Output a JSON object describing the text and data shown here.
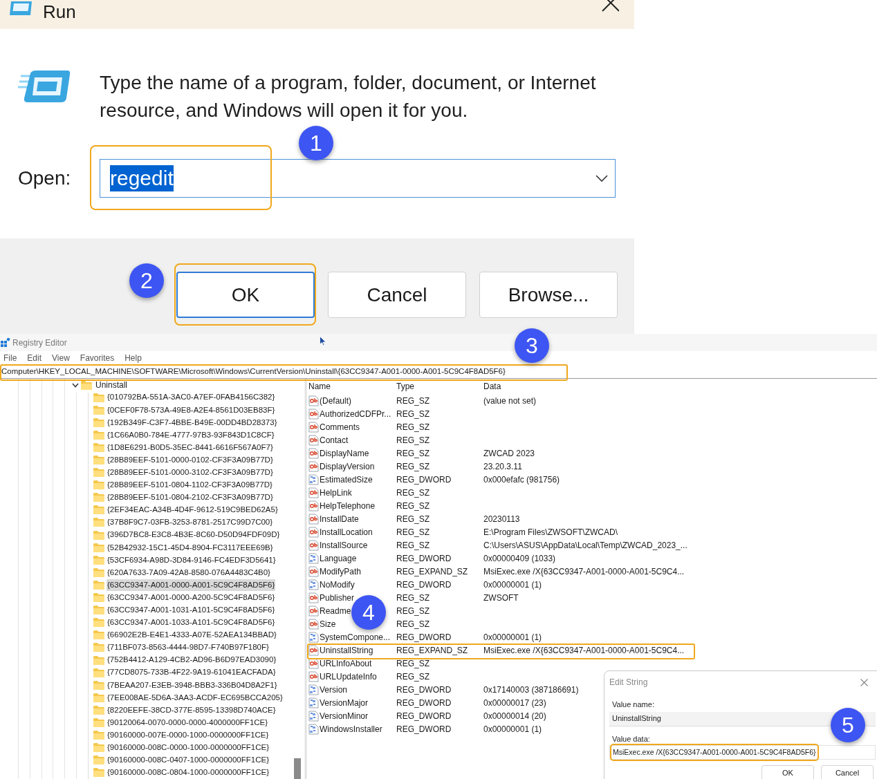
{
  "run_dialog": {
    "title": "Run",
    "description": "Type the name of a program, folder, document, or Internet resource, and Windows will open it for you.",
    "open_label": "Open:",
    "open_value": "regedit",
    "buttons": [
      {
        "label": "OK",
        "focused": true
      },
      {
        "label": "Cancel",
        "focused": false
      },
      {
        "label": "Browse...",
        "focused": false
      }
    ]
  },
  "registry_editor": {
    "title": "Registry Editor",
    "menu": [
      "File",
      "Edit",
      "View",
      "Favorites",
      "Help"
    ],
    "address": "Computer\\HKEY_LOCAL_MACHINE\\SOFTWARE\\Microsoft\\Windows\\CurrentVersion\\Uninstall\\{63CC9347-A001-0000-A001-5C9C4F8AD5F6}",
    "tree": {
      "label": "Uninstall",
      "expanded": true,
      "children": [
        {
          "label": "{010792BA-551A-3AC0-A7EF-0FAB4156C382}",
          "selected": false
        },
        {
          "label": "{0CEF0F78-573A-49E8-A2E4-8561D03EB83F}",
          "selected": false
        },
        {
          "label": "{192B349F-C3F7-4BBE-B49E-00DD4BD28373}",
          "selected": false
        },
        {
          "label": "{1C66A0B0-784E-4777-97B3-93F843D1C8CF}",
          "selected": false
        },
        {
          "label": "{1D8E6291-B0D5-35EC-8441-6616F567A0F7}",
          "selected": false
        },
        {
          "label": "{28B89EEF-5101-0000-0102-CF3F3A09B77D}",
          "selected": false
        },
        {
          "label": "{28B89EEF-5101-0000-3102-CF3F3A09B77D}",
          "selected": false
        },
        {
          "label": "{28B89EEF-5101-0804-1102-CF3F3A09B77D}",
          "selected": false
        },
        {
          "label": "{28B89EEF-5101-0804-2102-CF3F3A09B77D}",
          "selected": false
        },
        {
          "label": "{2EF34EAC-A34B-4D4F-9612-519C9BED62A5}",
          "selected": false
        },
        {
          "label": "{37B8F9C7-03FB-3253-8781-2517C99D7C00}",
          "selected": false
        },
        {
          "label": "{396D7BC8-E3C8-4B3E-8C60-D50D94FDF09D}",
          "selected": false
        },
        {
          "label": "{52B42932-15C1-45D4-8904-FC3117EEE69B}",
          "selected": false
        },
        {
          "label": "{53CF6934-A98D-3D84-9146-FC4EDF3D5641}",
          "selected": false
        },
        {
          "label": "{620A7633-7A09-42A8-8580-076A4483C4B0}",
          "selected": false
        },
        {
          "label": "{63CC9347-A001-0000-A001-5C9C4F8AD5F6}",
          "selected": true
        },
        {
          "label": "{63CC9347-A001-0000-A200-5C9C4F8AD5F6}",
          "selected": false
        },
        {
          "label": "{63CC9347-A001-1031-A101-5C9C4F8AD5F6}",
          "selected": false
        },
        {
          "label": "{63CC9347-A001-1033-A101-5C9C4F8AD5F6}",
          "selected": false
        },
        {
          "label": "{66902E2B-E4E1-4333-A07E-52AEA134BBAD}",
          "selected": false
        },
        {
          "label": "{711BF073-8563-4444-98D7-F740B97F180F}",
          "selected": false
        },
        {
          "label": "{752B4412-A129-4CB2-AD96-B6D97EAD3090}",
          "selected": false
        },
        {
          "label": "{77CD8075-733B-4F22-9A19-61041EACFADA}",
          "selected": false
        },
        {
          "label": "{7BEAA207-E3EB-3948-BBB3-336B04D8A2F1}",
          "selected": false
        },
        {
          "label": "{7EE008AE-5D6A-3AA3-ACDF-EC695BCCA205}",
          "selected": false
        },
        {
          "label": "{8220EEFE-38CD-377E-8595-13398D740ACE}",
          "selected": false
        },
        {
          "label": "{90120064-0070-0000-0000-4000000FF1CE}",
          "selected": false
        },
        {
          "label": "{90160000-007E-0000-1000-0000000FF1CE}",
          "selected": false
        },
        {
          "label": "{90160000-008C-0000-1000-0000000FF1CE}",
          "selected": false
        },
        {
          "label": "{90160000-008C-0407-1000-0000000FF1CE}",
          "selected": false
        },
        {
          "label": "{90160000-008C-0804-1000-0000000FF1CE}",
          "selected": false
        }
      ]
    },
    "columns": [
      "Name",
      "Type",
      "Data"
    ],
    "values": [
      {
        "kind": "string",
        "name": "(Default)",
        "type": "REG_SZ",
        "data": "(value not set)"
      },
      {
        "kind": "string",
        "name": "AuthorizedCDFPr...",
        "type": "REG_SZ"
      },
      {
        "kind": "string",
        "name": "Comments",
        "type": "REG_SZ"
      },
      {
        "kind": "string",
        "name": "Contact",
        "type": "REG_SZ"
      },
      {
        "kind": "string",
        "name": "DisplayName",
        "type": "REG_SZ",
        "data": "ZWCAD 2023"
      },
      {
        "kind": "string",
        "name": "DisplayVersion",
        "type": "REG_SZ",
        "data": "23.20.3.11"
      },
      {
        "kind": "binary",
        "name": "EstimatedSize",
        "type": "REG_DWORD",
        "data": "0x000efafc (981756)"
      },
      {
        "kind": "string",
        "name": "HelpLink",
        "type": "REG_SZ"
      },
      {
        "kind": "string",
        "name": "HelpTelephone",
        "type": "REG_SZ"
      },
      {
        "kind": "string",
        "name": "InstallDate",
        "type": "REG_SZ",
        "data": "20230113"
      },
      {
        "kind": "string",
        "name": "InstallLocation",
        "type": "REG_SZ",
        "data": "E:\\Program Files\\ZWSOFT\\ZWCAD\\"
      },
      {
        "kind": "string",
        "name": "InstallSource",
        "type": "REG_SZ",
        "data": "C:\\Users\\ASUS\\AppData\\Local\\Temp\\ZWCAD_2023_..."
      },
      {
        "kind": "binary",
        "name": "Language",
        "type": "REG_DWORD",
        "data": "0x00000409 (1033)"
      },
      {
        "kind": "string",
        "name": "ModifyPath",
        "type": "REG_EXPAND_SZ",
        "data": "MsiExec.exe /X{63CC9347-A001-0000-A001-5C9C4..."
      },
      {
        "kind": "binary",
        "name": "NoModify",
        "type": "REG_DWORD",
        "data": "0x00000001 (1)"
      },
      {
        "kind": "string",
        "name": "Publisher",
        "type": "REG_SZ",
        "data": "ZWSOFT"
      },
      {
        "kind": "string",
        "name": "Readme",
        "type": "REG_SZ"
      },
      {
        "kind": "string",
        "name": "Size",
        "type": "REG_SZ"
      },
      {
        "kind": "binary",
        "name": "SystemCompone...",
        "type": "REG_DWORD",
        "data": "0x00000001 (1)"
      },
      {
        "kind": "string",
        "name": "UninstallString",
        "type": "REG_EXPAND_SZ",
        "data": "MsiExec.exe /X{63CC9347-A001-0000-A001-5C9C4..."
      },
      {
        "kind": "string",
        "name": "URLInfoAbout",
        "type": "REG_SZ"
      },
      {
        "kind": "string",
        "name": "URLUpdateInfo",
        "type": "REG_SZ"
      },
      {
        "kind": "binary",
        "name": "Version",
        "type": "REG_DWORD",
        "data": "0x17140003 (387186691)"
      },
      {
        "kind": "binary",
        "name": "VersionMajor",
        "type": "REG_DWORD",
        "data": "0x00000017 (23)"
      },
      {
        "kind": "binary",
        "name": "VersionMinor",
        "type": "REG_DWORD",
        "data": "0x00000014 (20)"
      },
      {
        "kind": "binary",
        "name": "WindowsInstaller",
        "type": "REG_DWORD",
        "data": "0x00000001 (1)"
      }
    ]
  },
  "edit_string": {
    "title": "Edit String",
    "value_name_label": "Value name:",
    "value_name": "UninstallString",
    "value_data_label": "Value data:",
    "value_data": "MsiExec.exe /X{63CC9347-A001-0000-A001-5C9C4F8AD5F6}",
    "buttons": [
      "OK",
      "Cancel"
    ]
  },
  "annotations": [
    "1",
    "2",
    "3",
    "4",
    "5"
  ]
}
